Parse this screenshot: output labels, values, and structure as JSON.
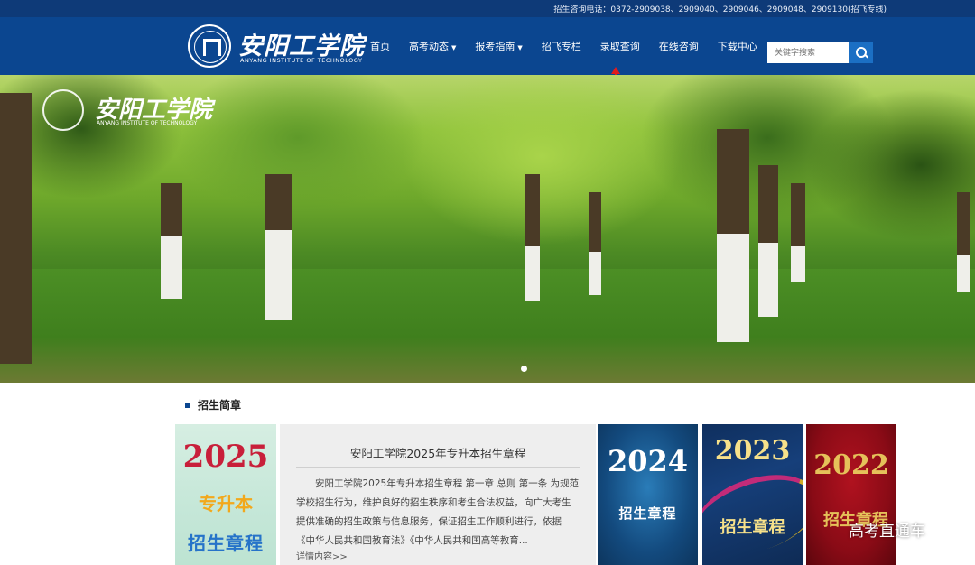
{
  "topbar": {
    "phone_text": "招生咨询电话：0372-2909038、2909040、2909046、2909048、2909130(招飞专线)"
  },
  "logo": {
    "cn": "安阳工学院",
    "en": "ANYANG INSTITUTE OF TECHNOLOGY"
  },
  "nav": {
    "items": [
      {
        "label": "首页",
        "caret": ""
      },
      {
        "label": "高考动态",
        "caret": "▼"
      },
      {
        "label": "报考指南",
        "caret": "▼"
      },
      {
        "label": "招飞专栏",
        "caret": ""
      },
      {
        "label": "录取查询",
        "caret": ""
      },
      {
        "label": "在线咨询",
        "caret": ""
      },
      {
        "label": "下载中心",
        "caret": ""
      }
    ]
  },
  "search": {
    "placeholder": "关键字搜索"
  },
  "banner": {
    "logo_cn": "安阳工学院",
    "logo_en": "ANYANG INSTITUTE OF TECHNOLOGY",
    "active_slide": 1,
    "slide_count": 1
  },
  "section": {
    "title": "招生简章"
  },
  "cards": {
    "c2025": {
      "year": "2025",
      "line1": "专升本",
      "line2": "招生章程"
    },
    "c2024": {
      "year": "2024",
      "label": "招生章程"
    },
    "c2023": {
      "year": "2023",
      "label": "招生章程"
    },
    "c2022": {
      "year": "2022",
      "label": "招生章程"
    }
  },
  "article": {
    "title": "安阳工学院2025年专升本招生章程",
    "body": "安阳工学院2025年专升本招生章程 第一章 总则 第一条 为规范学校招生行为，维护良好的招生秩序和考生合法权益，向广大考生提供准确的招生政策与信息服务，保证招生工作顺利进行，依据《中华人民共和国教育法》《中华人民共和国高等教育...",
    "more": "详情内容>>"
  },
  "watermark": "高考直通车",
  "colors": {
    "topbar": "#0e3a78",
    "header": "#0b4690",
    "search_button": "#1b6fc4",
    "arrow": "#e21b1b"
  }
}
